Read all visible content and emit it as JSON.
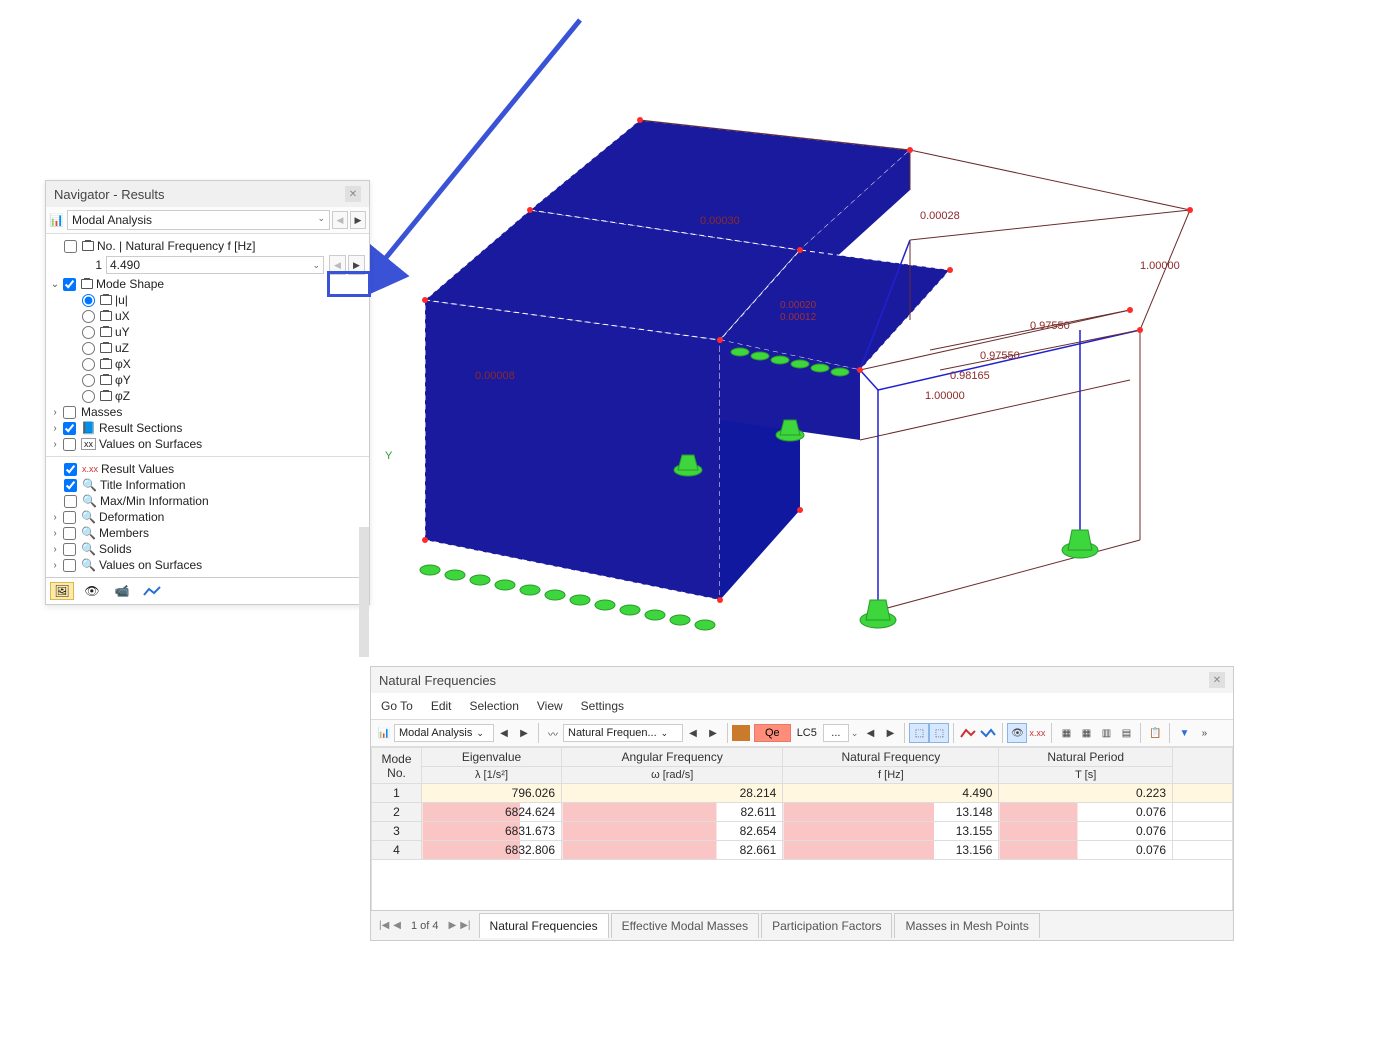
{
  "navigator": {
    "title": "Navigator - Results",
    "analysis_type": "Modal Analysis",
    "freq_header": "No. | Natural Frequency f [Hz]",
    "mode_no": "1",
    "mode_freq": "4.490",
    "tree": {
      "mode_shape": "Mode Shape",
      "u_abs": "|u|",
      "ux": "uX",
      "uy": "uY",
      "uz": "uZ",
      "phix": "φX",
      "phiy": "φY",
      "phiz": "φZ",
      "masses": "Masses",
      "result_sections": "Result Sections",
      "values_on_surfaces": "Values on Surfaces",
      "result_values": "Result Values",
      "title_info": "Title Information",
      "maxmin_info": "Max/Min Information",
      "deformation": "Deformation",
      "members": "Members",
      "solids": "Solids",
      "values_on_surfaces2": "Values on Surfaces"
    }
  },
  "viewport_labels": {
    "l1": "0.00030",
    "l2": "0.00028",
    "l3": "1.00000",
    "l4": "0.97550",
    "l5": "0.97550",
    "l6": "0.98165",
    "l7": "1.00000",
    "l8": "0.00020",
    "l9": "0.00012",
    "l10": "0.00008",
    "axis_y": "Y"
  },
  "results": {
    "title": "Natural Frequencies",
    "menu": [
      "Go To",
      "Edit",
      "Selection",
      "View",
      "Settings"
    ],
    "tb_analysis": "Modal Analysis",
    "tb_result": "Natural Frequen...",
    "qe": "Qe",
    "lc5": "LC5",
    "ellipsis": "...",
    "headers": {
      "mode_no": "Mode\nNo.",
      "eigenvalue": "Eigenvalue",
      "eigenvalue_sub": "λ [1/s²]",
      "angfreq": "Angular Frequency",
      "angfreq_sub": "ω [rad/s]",
      "natfreq": "Natural Frequency",
      "natfreq_sub": "f [Hz]",
      "natperiod": "Natural Period",
      "natperiod_sub": "T [s]"
    },
    "rows": [
      {
        "no": "1",
        "ev": "796.026",
        "af": "28.214",
        "nf": "4.490",
        "np": "0.223"
      },
      {
        "no": "2",
        "ev": "6824.624",
        "af": "82.611",
        "nf": "13.148",
        "np": "0.076"
      },
      {
        "no": "3",
        "ev": "6831.673",
        "af": "82.654",
        "nf": "13.155",
        "np": "0.076"
      },
      {
        "no": "4",
        "ev": "6832.806",
        "af": "82.661",
        "nf": "13.156",
        "np": "0.076"
      }
    ],
    "pager": "1 of 4",
    "tabs": [
      "Natural Frequencies",
      "Effective Modal Masses",
      "Participation Factors",
      "Masses in Mesh Points"
    ]
  }
}
